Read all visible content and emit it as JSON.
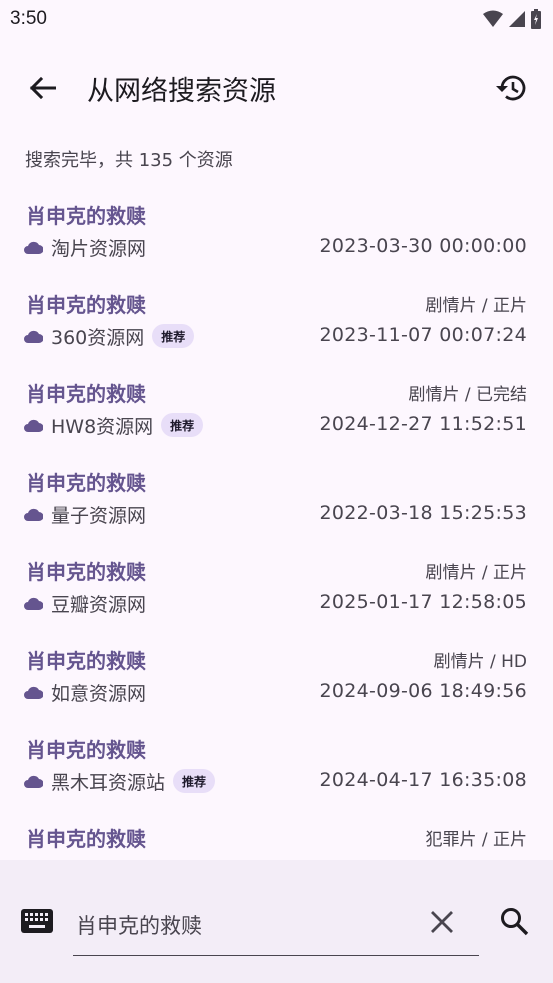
{
  "status_bar": {
    "time": "3:50"
  },
  "app_bar": {
    "title": "从网络搜索资源"
  },
  "summary": "搜索完毕，共 135 个资源",
  "results": [
    {
      "title": "肖申克的救赎",
      "category": "",
      "source": "淘片资源网",
      "badge": "",
      "time": "2023-03-30 00:00:00"
    },
    {
      "title": "肖申克的救赎",
      "category": "剧情片 / 正片",
      "source": "360资源网",
      "badge": "推荐",
      "time": "2023-11-07 00:07:24"
    },
    {
      "title": "肖申克的救赎",
      "category": "剧情片 / 已完结",
      "source": "HW8资源网",
      "badge": "推荐",
      "time": "2024-12-27 11:52:51"
    },
    {
      "title": "肖申克的救赎",
      "category": "",
      "source": "量子资源网",
      "badge": "",
      "time": "2022-03-18 15:25:53"
    },
    {
      "title": "肖申克的救赎",
      "category": "剧情片 / 正片",
      "source": "豆瓣资源网",
      "badge": "",
      "time": "2025-01-17 12:58:05"
    },
    {
      "title": "肖申克的救赎",
      "category": "剧情片 / HD",
      "source": "如意资源网",
      "badge": "",
      "time": "2024-09-06 18:49:56"
    },
    {
      "title": "肖申克的救赎",
      "category": "",
      "source": "黑木耳资源站",
      "badge": "推荐",
      "time": "2024-04-17 16:35:08"
    },
    {
      "title": "肖申克的救赎",
      "category": "犯罪片 / 正片",
      "source": "",
      "badge": "",
      "time": ""
    }
  ],
  "search": {
    "value": "肖申克的救赎"
  },
  "icons": {
    "back": "arrow-back-icon",
    "history": "history-icon",
    "cloud": "cloud-icon",
    "keyboard": "keyboard-icon",
    "clear": "close-icon",
    "search": "search-icon"
  },
  "colors": {
    "accent": "#65558F",
    "badge_bg": "#E8DEF8",
    "background": "#FDF7FE",
    "bottom_bar": "#F3EDF7"
  }
}
